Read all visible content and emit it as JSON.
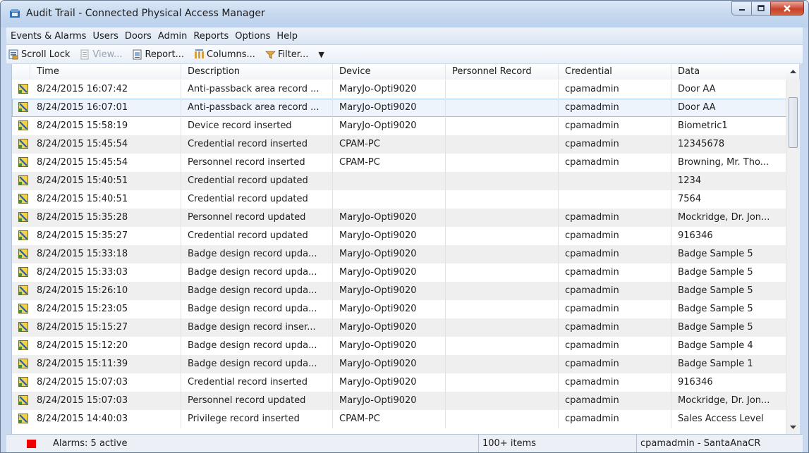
{
  "window": {
    "title": "Audit Trail - Connected Physical Access Manager"
  },
  "menu": [
    "Events & Alarms",
    "Users",
    "Doors",
    "Admin",
    "Reports",
    "Options",
    "Help"
  ],
  "toolbar": {
    "scroll_lock": "Scroll Lock",
    "view": "View...",
    "report": "Report...",
    "columns": "Columns...",
    "filter": "Filter...",
    "dropdown": "▼"
  },
  "table": {
    "columns": [
      "Time",
      "Description",
      "Device",
      "Personnel Record",
      "Credential",
      "Data"
    ],
    "rows": [
      {
        "time": "8/24/2015 16:07:42",
        "description": "Anti-passback area record ...",
        "device": "MaryJo-Opti9020",
        "personnel": "",
        "credential": "cpamadmin",
        "data": "Door AA"
      },
      {
        "time": "8/24/2015 16:07:01",
        "description": "Anti-passback area record ...",
        "device": "MaryJo-Opti9020",
        "personnel": "",
        "credential": "cpamadmin",
        "data": "Door AA"
      },
      {
        "time": "8/24/2015 15:58:19",
        "description": "Device record inserted",
        "device": "MaryJo-Opti9020",
        "personnel": "",
        "credential": "cpamadmin",
        "data": "Biometric1"
      },
      {
        "time": "8/24/2015 15:45:54",
        "description": "Credential record inserted",
        "device": "CPAM-PC",
        "personnel": "",
        "credential": "cpamadmin",
        "data": "12345678"
      },
      {
        "time": "8/24/2015 15:45:54",
        "description": "Personnel record inserted",
        "device": "CPAM-PC",
        "personnel": "",
        "credential": "cpamadmin",
        "data": "Browning, Mr. Tho..."
      },
      {
        "time": "8/24/2015 15:40:51",
        "description": "Credential record updated",
        "device": "",
        "personnel": "",
        "credential": "",
        "data": "1234"
      },
      {
        "time": "8/24/2015 15:40:51",
        "description": "Credential record updated",
        "device": "",
        "personnel": "",
        "credential": "",
        "data": "7564"
      },
      {
        "time": "8/24/2015 15:35:28",
        "description": "Personnel record updated",
        "device": "MaryJo-Opti9020",
        "personnel": "",
        "credential": "cpamadmin",
        "data": "Mockridge, Dr. Jon..."
      },
      {
        "time": "8/24/2015 15:35:27",
        "description": "Credential record updated",
        "device": "MaryJo-Opti9020",
        "personnel": "",
        "credential": "cpamadmin",
        "data": "916346"
      },
      {
        "time": "8/24/2015 15:33:18",
        "description": "Badge design record upda...",
        "device": "MaryJo-Opti9020",
        "personnel": "",
        "credential": "cpamadmin",
        "data": "Badge Sample 5"
      },
      {
        "time": "8/24/2015 15:33:03",
        "description": "Badge design record upda...",
        "device": "MaryJo-Opti9020",
        "personnel": "",
        "credential": "cpamadmin",
        "data": "Badge Sample 5"
      },
      {
        "time": "8/24/2015 15:26:10",
        "description": "Badge design record upda...",
        "device": "MaryJo-Opti9020",
        "personnel": "",
        "credential": "cpamadmin",
        "data": "Badge Sample 5"
      },
      {
        "time": "8/24/2015 15:23:05",
        "description": "Badge design record upda...",
        "device": "MaryJo-Opti9020",
        "personnel": "",
        "credential": "cpamadmin",
        "data": "Badge Sample 5"
      },
      {
        "time": "8/24/2015 15:15:27",
        "description": "Badge design record inser...",
        "device": "MaryJo-Opti9020",
        "personnel": "",
        "credential": "cpamadmin",
        "data": "Badge Sample 5"
      },
      {
        "time": "8/24/2015 15:12:20",
        "description": "Badge design record upda...",
        "device": "MaryJo-Opti9020",
        "personnel": "",
        "credential": "cpamadmin",
        "data": "Badge Sample 4"
      },
      {
        "time": "8/24/2015 15:11:39",
        "description": "Badge design record upda...",
        "device": "MaryJo-Opti9020",
        "personnel": "",
        "credential": "cpamadmin",
        "data": "Badge Sample 1"
      },
      {
        "time": "8/24/2015 15:07:03",
        "description": "Credential record inserted",
        "device": "MaryJo-Opti9020",
        "personnel": "",
        "credential": "cpamadmin",
        "data": "916346"
      },
      {
        "time": "8/24/2015 15:07:03",
        "description": "Personnel record updated",
        "device": "MaryJo-Opti9020",
        "personnel": "",
        "credential": "cpamadmin",
        "data": "Mockridge, Dr. Jon..."
      },
      {
        "time": "8/24/2015 14:40:03",
        "description": "Privilege record inserted",
        "device": "CPAM-PC",
        "personnel": "",
        "credential": "cpamadmin",
        "data": "Sales Access Level"
      }
    ]
  },
  "status": {
    "alarms": "Alarms: 5 active",
    "items": "100+ items",
    "user": "cpamadmin - SantaAnaCR"
  },
  "colors": {
    "alarm": "#ee0000",
    "selection_border": "#9ec1e8",
    "alt_row": "#efefef"
  }
}
